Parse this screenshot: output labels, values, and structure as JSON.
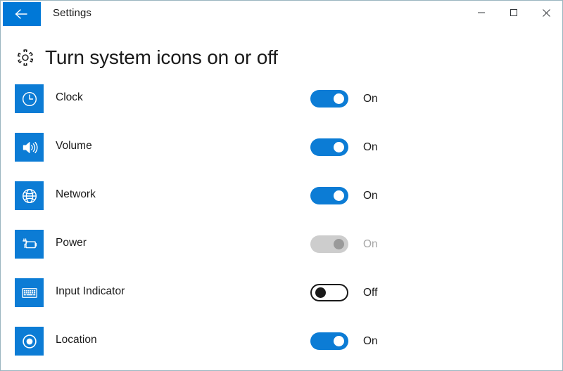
{
  "window": {
    "title": "Settings",
    "back_icon": "back-arrow-icon",
    "controls": [
      {
        "name": "minimize",
        "glyph": "minimize-icon"
      },
      {
        "name": "maximize",
        "glyph": "maximize-icon"
      },
      {
        "name": "close",
        "glyph": "close-icon"
      }
    ]
  },
  "header": {
    "icon": "gear-icon",
    "title": "Turn system icons on or off"
  },
  "colors": {
    "accent": "#0078d7",
    "tile": "#0c7cd5",
    "toggle_on": "#0c7cd5",
    "toggle_disabled": "#cdcdcd",
    "toggle_disabled_knob": "#9a9a9a",
    "text": "#1a1a1a",
    "text_disabled": "#a6a6a6",
    "window_border": "#9ab5bf"
  },
  "rows": [
    {
      "label": "Clock",
      "icon": "clock-icon",
      "state": "On",
      "enabled": true,
      "on": true
    },
    {
      "label": "Volume",
      "icon": "speaker-icon",
      "state": "On",
      "enabled": true,
      "on": true
    },
    {
      "label": "Network",
      "icon": "globe-icon",
      "state": "On",
      "enabled": true,
      "on": true
    },
    {
      "label": "Power",
      "icon": "battery-icon",
      "state": "On",
      "enabled": false,
      "on": true
    },
    {
      "label": "Input Indicator",
      "icon": "keyboard-icon",
      "state": "Off",
      "enabled": true,
      "on": false
    },
    {
      "label": "Location",
      "icon": "location-icon",
      "state": "On",
      "enabled": true,
      "on": true
    }
  ]
}
